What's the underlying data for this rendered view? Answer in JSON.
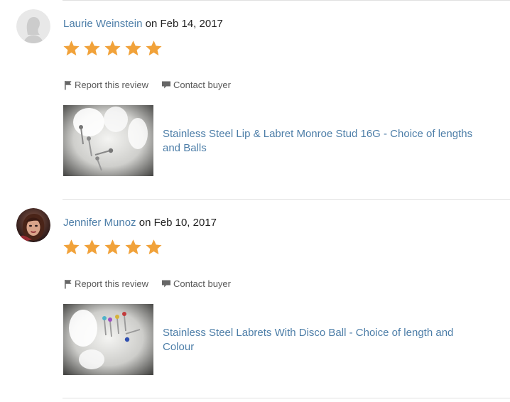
{
  "accent_link_color": "#4d7ea8",
  "star_color": "#f1a23a",
  "reviews": [
    {
      "reviewer": "Laurie Weinstein",
      "on_text": "on",
      "date": "Feb 14, 2017",
      "rating": 5,
      "avatar_icon": "default-user-silhouette-icon",
      "report_label": "Report this review",
      "contact_label": "Contact buyer",
      "product_title": "Stainless Steel Lip & Labret Monroe Stud 16G - Choice of lengths and Balls"
    },
    {
      "reviewer": "Jennifer Munoz",
      "on_text": "on",
      "date": "Feb 10, 2017",
      "rating": 5,
      "avatar_icon": "user-photo-avatar",
      "report_label": "Report this review",
      "contact_label": "Contact buyer",
      "product_title": "Stainless Steel Labrets With Disco Ball - Choice of length and Colour"
    }
  ]
}
